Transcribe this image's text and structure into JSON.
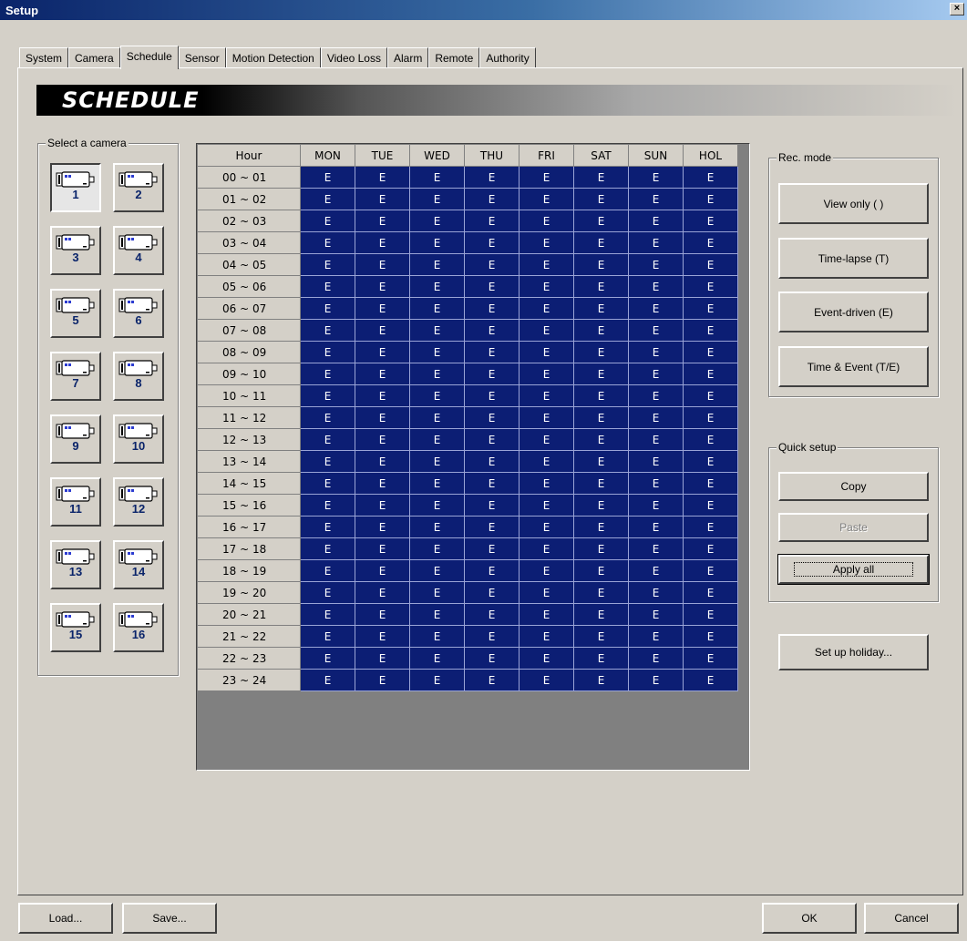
{
  "window": {
    "title": "Setup",
    "close_glyph": "×"
  },
  "tabs": [
    {
      "label": "System"
    },
    {
      "label": "Camera"
    },
    {
      "label": "Schedule",
      "active": true
    },
    {
      "label": "Sensor"
    },
    {
      "label": "Motion Detection"
    },
    {
      "label": "Video Loss"
    },
    {
      "label": "Alarm"
    },
    {
      "label": "Remote"
    },
    {
      "label": "Authority"
    }
  ],
  "banner": {
    "title": "SCHEDULE"
  },
  "camera_select": {
    "label": "Select a camera",
    "selected": "1",
    "cameras": [
      "1",
      "2",
      "3",
      "4",
      "5",
      "6",
      "7",
      "8",
      "9",
      "10",
      "11",
      "12",
      "13",
      "14",
      "15",
      "16"
    ],
    "icon": "camera-icon"
  },
  "schedule": {
    "hour_header": "Hour",
    "days": [
      "MON",
      "TUE",
      "WED",
      "THU",
      "FRI",
      "SAT",
      "SUN",
      "HOL"
    ],
    "rows": [
      {
        "hour": "00 ~ 01",
        "values": [
          "E",
          "E",
          "E",
          "E",
          "E",
          "E",
          "E",
          "E"
        ]
      },
      {
        "hour": "01 ~ 02",
        "values": [
          "E",
          "E",
          "E",
          "E",
          "E",
          "E",
          "E",
          "E"
        ]
      },
      {
        "hour": "02 ~ 03",
        "values": [
          "E",
          "E",
          "E",
          "E",
          "E",
          "E",
          "E",
          "E"
        ]
      },
      {
        "hour": "03 ~ 04",
        "values": [
          "E",
          "E",
          "E",
          "E",
          "E",
          "E",
          "E",
          "E"
        ]
      },
      {
        "hour": "04 ~ 05",
        "values": [
          "E",
          "E",
          "E",
          "E",
          "E",
          "E",
          "E",
          "E"
        ]
      },
      {
        "hour": "05 ~ 06",
        "values": [
          "E",
          "E",
          "E",
          "E",
          "E",
          "E",
          "E",
          "E"
        ]
      },
      {
        "hour": "06 ~ 07",
        "values": [
          "E",
          "E",
          "E",
          "E",
          "E",
          "E",
          "E",
          "E"
        ]
      },
      {
        "hour": "07 ~ 08",
        "values": [
          "E",
          "E",
          "E",
          "E",
          "E",
          "E",
          "E",
          "E"
        ]
      },
      {
        "hour": "08 ~ 09",
        "values": [
          "E",
          "E",
          "E",
          "E",
          "E",
          "E",
          "E",
          "E"
        ]
      },
      {
        "hour": "09 ~ 10",
        "values": [
          "E",
          "E",
          "E",
          "E",
          "E",
          "E",
          "E",
          "E"
        ]
      },
      {
        "hour": "10 ~ 11",
        "values": [
          "E",
          "E",
          "E",
          "E",
          "E",
          "E",
          "E",
          "E"
        ]
      },
      {
        "hour": "11 ~ 12",
        "values": [
          "E",
          "E",
          "E",
          "E",
          "E",
          "E",
          "E",
          "E"
        ]
      },
      {
        "hour": "12 ~ 13",
        "values": [
          "E",
          "E",
          "E",
          "E",
          "E",
          "E",
          "E",
          "E"
        ]
      },
      {
        "hour": "13 ~ 14",
        "values": [
          "E",
          "E",
          "E",
          "E",
          "E",
          "E",
          "E",
          "E"
        ]
      },
      {
        "hour": "14 ~ 15",
        "values": [
          "E",
          "E",
          "E",
          "E",
          "E",
          "E",
          "E",
          "E"
        ]
      },
      {
        "hour": "15 ~ 16",
        "values": [
          "E",
          "E",
          "E",
          "E",
          "E",
          "E",
          "E",
          "E"
        ]
      },
      {
        "hour": "16 ~ 17",
        "values": [
          "E",
          "E",
          "E",
          "E",
          "E",
          "E",
          "E",
          "E"
        ]
      },
      {
        "hour": "17 ~ 18",
        "values": [
          "E",
          "E",
          "E",
          "E",
          "E",
          "E",
          "E",
          "E"
        ]
      },
      {
        "hour": "18 ~ 19",
        "values": [
          "E",
          "E",
          "E",
          "E",
          "E",
          "E",
          "E",
          "E"
        ]
      },
      {
        "hour": "19 ~ 20",
        "values": [
          "E",
          "E",
          "E",
          "E",
          "E",
          "E",
          "E",
          "E"
        ]
      },
      {
        "hour": "20 ~ 21",
        "values": [
          "E",
          "E",
          "E",
          "E",
          "E",
          "E",
          "E",
          "E"
        ]
      },
      {
        "hour": "21 ~ 22",
        "values": [
          "E",
          "E",
          "E",
          "E",
          "E",
          "E",
          "E",
          "E"
        ]
      },
      {
        "hour": "22 ~ 23",
        "values": [
          "E",
          "E",
          "E",
          "E",
          "E",
          "E",
          "E",
          "E"
        ]
      },
      {
        "hour": "23 ~ 24",
        "values": [
          "E",
          "E",
          "E",
          "E",
          "E",
          "E",
          "E",
          "E"
        ]
      }
    ]
  },
  "rec_mode": {
    "label": "Rec. mode",
    "view_only": "View only ( )",
    "time_lapse": "Time-lapse (T)",
    "event_driven": "Event-driven (E)",
    "time_event": "Time & Event (T/E)"
  },
  "quick_setup": {
    "label": "Quick setup",
    "copy": "Copy",
    "paste": "Paste",
    "apply_all": "Apply all"
  },
  "holiday_button": "Set up holiday...",
  "footer": {
    "load": "Load...",
    "save": "Save...",
    "ok": "OK",
    "cancel": "Cancel"
  },
  "colors": {
    "cell_bg": "#0c1e74",
    "cell_text": "#ffffff",
    "camera_number": "#0a246a",
    "dialog_bg": "#d4d0c8"
  }
}
